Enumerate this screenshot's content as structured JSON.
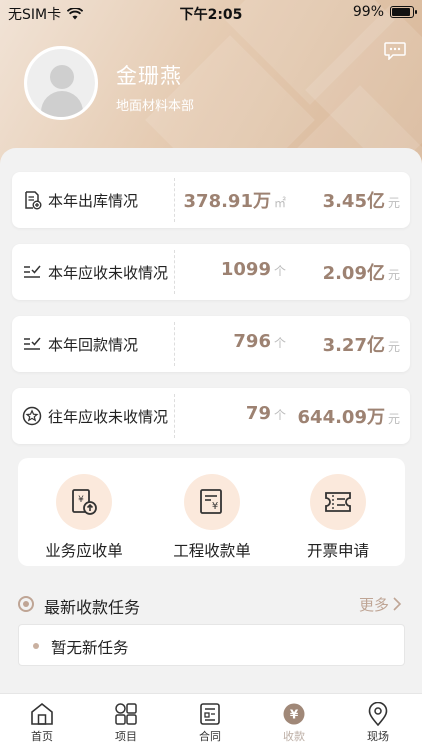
{
  "status_bar": {
    "carrier": "无SIM卡",
    "time": "下午2:05",
    "battery": "99%",
    "battery_level": 0.99
  },
  "profile": {
    "name": "金珊燕",
    "department": "地面材料本部"
  },
  "stats": [
    {
      "label": "本年出库情况",
      "value1": "378.91万",
      "unit1": "㎡",
      "value2": "3.45亿",
      "unit2": "元",
      "icon": "document-add-icon"
    },
    {
      "label": "本年应收未收情况",
      "value1": "1099",
      "unit1": "个",
      "value2": "2.09亿",
      "unit2": "元",
      "icon": "list-check-icon"
    },
    {
      "label": "本年回款情况",
      "value1": "796",
      "unit1": "个",
      "value2": "3.27亿",
      "unit2": "元",
      "icon": "list-check-icon"
    },
    {
      "label": "往年应收未收情况",
      "value1": "79",
      "unit1": "个",
      "value2": "644.09万",
      "unit2": "元",
      "icon": "star-circle-icon"
    }
  ],
  "actions": [
    {
      "label": "业务应收单",
      "icon": "receivable-doc-icon"
    },
    {
      "label": "工程收款单",
      "icon": "payment-doc-icon"
    },
    {
      "label": "开票申请",
      "icon": "invoice-ticket-icon"
    }
  ],
  "tasks": {
    "title": "最新收款任务",
    "more": "更多",
    "empty": "暂无新任务"
  },
  "tabs": [
    {
      "label": "首页",
      "icon": "home-icon"
    },
    {
      "label": "项目",
      "icon": "grid-icon"
    },
    {
      "label": "合同",
      "icon": "contract-icon"
    },
    {
      "label": "收款",
      "icon": "yuan-icon"
    },
    {
      "label": "现场",
      "icon": "location-icon"
    }
  ],
  "colors": {
    "accent": "#9d8272",
    "hero_start": "#f1e3d6",
    "hero_end": "#d7b596",
    "action_circle": "#fbe9dc"
  }
}
